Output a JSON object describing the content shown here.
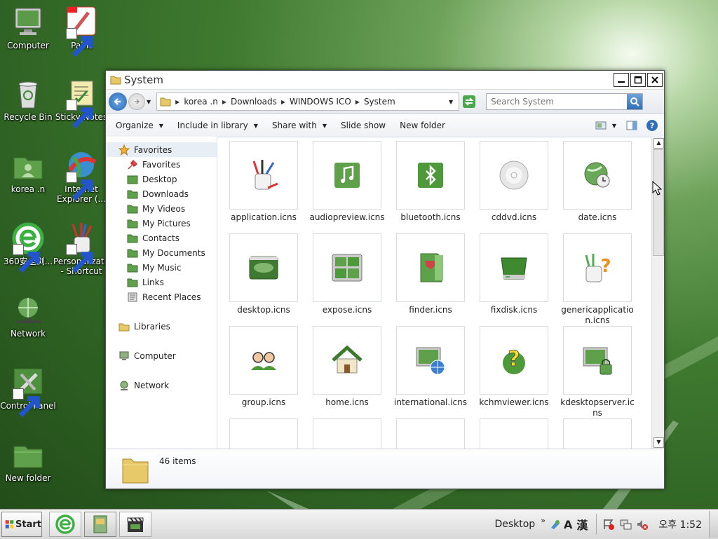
{
  "desktop": {
    "icons": [
      {
        "label": "Computer"
      },
      {
        "label": "Paint"
      },
      {
        "label": "Recycle Bin"
      },
      {
        "label": "Sticky Notes"
      },
      {
        "label": "korea .n"
      },
      {
        "label": "Internet Explorer (..."
      },
      {
        "label": "360安全浏..."
      },
      {
        "label": "Personalizat... - Shortcut"
      },
      {
        "label": "Network"
      },
      {
        "label": "Control Panel"
      },
      {
        "label": "New folder"
      }
    ]
  },
  "window": {
    "title": "System",
    "breadcrumb": [
      "korea .n",
      "Downloads",
      "WINDOWS ICO",
      "System"
    ],
    "search_placeholder": "Search System",
    "toolbar": {
      "organize": "Organize",
      "include": "Include in library",
      "share": "Share with",
      "slideshow": "Slide show",
      "new_folder": "New folder"
    },
    "nav": {
      "favorites_header": "Favorites",
      "favorites": [
        "Favorites",
        "Desktop",
        "Downloads",
        "My Videos",
        "My Pictures",
        "Contacts",
        "My Documents",
        "My Music",
        "Links",
        "Recent Places"
      ],
      "libraries": "Libraries",
      "computer": "Computer",
      "network": "Network"
    },
    "files": [
      "application.icns",
      "audiopreview.icns",
      "bluetooth.icns",
      "cddvd.icns",
      "date.icns",
      "desktop.icns",
      "expose.icns",
      "finder.icns",
      "fixdisk.icns",
      "genericapplication.icns",
      "group.icns",
      "home.icns",
      "international.icns",
      "kchmviewer.icns",
      "kdesktopserver.icns"
    ],
    "status": "46 items"
  },
  "taskbar": {
    "start": "Start",
    "desktop": "Desktop",
    "ime_a": "A",
    "ime_han": "漢",
    "clock": "오후 1:52"
  },
  "colors": {
    "accent": "#4e9a3a",
    "titlebar": "#ffffff",
    "selection": "#e8eef6"
  }
}
